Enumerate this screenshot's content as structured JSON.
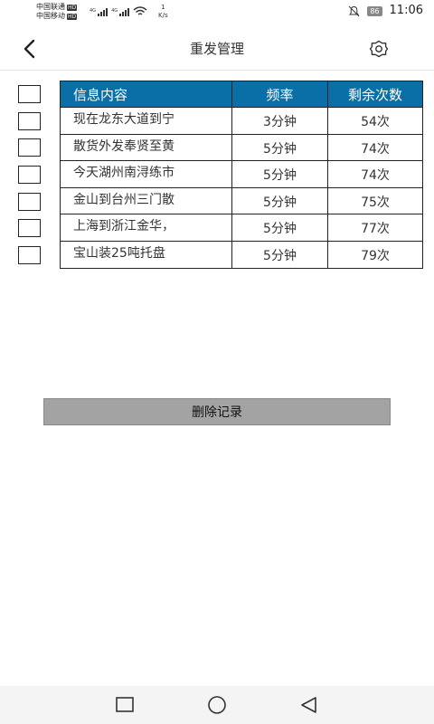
{
  "status_bar": {
    "carrier_1": "中国联通",
    "carrier_2": "中国移动",
    "hd_badge": "HD",
    "net_tag": "4G",
    "speed_value": "1",
    "speed_unit": "K/s",
    "battery": "86",
    "time": "11:06"
  },
  "header": {
    "title": "重发管理",
    "back_icon": "chevron-left-icon",
    "settings_icon": "gear-icon"
  },
  "table": {
    "columns": [
      "信息内容",
      "频率",
      "剩余次数"
    ],
    "rows": [
      {
        "content": "现在龙东大道到宁",
        "frequency": "3分钟",
        "remaining": "54次"
      },
      {
        "content": "散货外发奉贤至黄",
        "frequency": "5分钟",
        "remaining": "74次"
      },
      {
        "content": "今天湖州南浔练市",
        "frequency": "5分钟",
        "remaining": "74次"
      },
      {
        "content": "金山到台州三门散",
        "frequency": "5分钟",
        "remaining": "75次"
      },
      {
        "content": "上海到浙江金华，",
        "frequency": "5分钟",
        "remaining": "77次"
      },
      {
        "content": "宝山装25吨托盘",
        "frequency": "5分钟",
        "remaining": "79次"
      }
    ]
  },
  "actions": {
    "delete_label": "删除记录"
  },
  "nav_bar": {
    "recent_icon": "square-icon",
    "home_icon": "circle-icon",
    "back_icon": "triangle-back-icon"
  },
  "colors": {
    "table_header_bg": "#0a6fa6",
    "table_header_text": "#ffffff",
    "delete_button_bg": "#a3a3a3"
  }
}
